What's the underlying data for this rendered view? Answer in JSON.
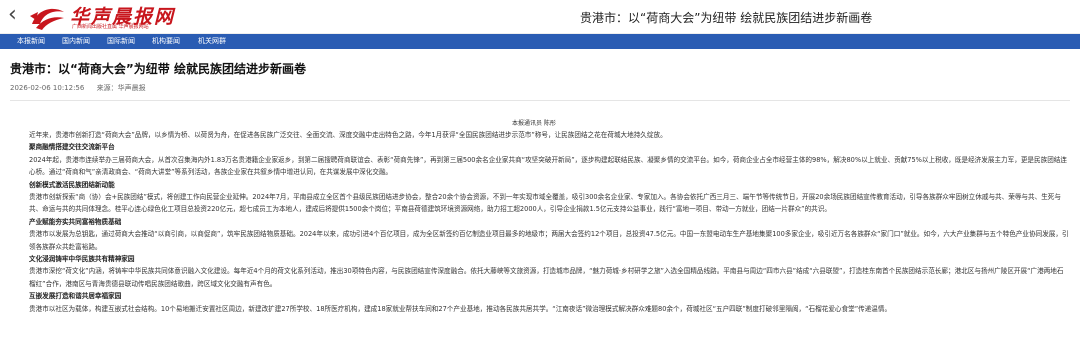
{
  "topbar": {
    "back_label": "‹",
    "logo_name": "华声晨报网",
    "logo_sub": "广西新闻出版社直属 华声晨报网站",
    "title": "贵港市：以“荷商大会”为纽带 绘就民族团结进步新画卷"
  },
  "nav": {
    "items": [
      "本报新闻",
      "国内新闻",
      "国际新闻",
      "机构要闻",
      "机关网群"
    ]
  },
  "article": {
    "headline": "贵港市：以“荷商大会”为纽带 绘就民族团结进步新画卷",
    "date": "2026-02-06 10:12:56",
    "source": "来源：华声晨报",
    "byline": "本报通讯员 陈彤",
    "blocks": [
      {
        "type": "p",
        "text": "近年来，贵港市创新打造“荷商大会”品牌，以乡情为桥、以荷贤为舟，在促进各民族广泛交往、全面交流、深度交融中走出特色之路，今年1月获评“全国民族团结进步示范市”称号，让民族团结之花在荷城大地持久绽放。"
      },
      {
        "type": "h",
        "text": "聚商融情搭建交往交流新平台"
      },
      {
        "type": "p",
        "text": "2024年起，贵港市连续举办三届荷商大会，从首次召集海内外1.83万名贵港籍企业家返乡，到第二届搜聘荷商联谊会、表彰“荷商先锋”，再到第三届500余名企业家共商“攻坚突破开新局”，逐步构建起联结民族、凝聚乡情的交流平台。如今，荷商企业占全市经营主体的98%，解决80%以上就业、贡献75%以上税收，既是经济发展主力军，更是民族团结连心桥。通过“荷商和气”亲清政商会、“荷商大讲堂”等系列活动，各族企业家在共叙乡情中增进认同，在共谋发展中深化交融。"
      },
      {
        "type": "h",
        "text": "创新模式激活民族团结新动能"
      },
      {
        "type": "p",
        "text": "贵港市创新探索“商（协）会+民族团结”模式，将创建工作向民营企业延伸。2024年7月，平南县成立全区首个县级民族团结进步协会，整合20余个协会资源，不到一年实现市域全覆盖，吸引300余名企业家、专家加入。各协会依托广西三月三、端午节等传统节日，开展20余场民族团结宣传教育活动，引导各族群众牢固树立休戚与共、荣辱与共、生死与共、命运与共的共同体理念。桂平心连心绿色化工项目总投资220亿元，超七成员工为本地人，建成后将提供1500余个岗位；平南县荷德建筑环境资源网络，助力招工超2000人，引导企业捐款1.5亿元支持公益事业，践行“富地一项目、带动一方就业，团结一片群众”的共识。"
      },
      {
        "type": "h",
        "text": "产业赋能夯实共同富裕物质基础"
      },
      {
        "type": "p",
        "text": "贵港市以发展为总钥匙，通过荷商大会推动“以商引商，以商促商”，筑牢民族团结物质基础。2024年以来，成功引进4个百亿项目，成为全区新签约百亿制造业项目最多的地级市；两届大会签约12个项目，总投资47.5亿元。中国一东盟电动车生产基地集聚100多家企业，吸引近万名各族群众“家门口”就业。如今，六大产业集群与五个特色产业协同发展，引领各族群众共赴富裕路。"
      },
      {
        "type": "h",
        "text": "文化浸润铸牢中华民族共有精神家园"
      },
      {
        "type": "p",
        "text": "贵港市深挖“荷文化”内涵，将铸牢中华民族共同体意识融入文化建设。每年近4个月的荷文化系列活动，推出30项特色内容，与民族团结宣传深度融合。依托大藤峡等文旅资源，打造城市品牌，“魅力荷城·乡村研学之旅”入选全国精品线路。平南县与周边“四市六县”结成“六县联盟”，打造桂东南首个民族团结示范长廊；港北区与扬州广陵区开展“广港两地石榴红”合作，港南区与青海贵德县联动传唱民族团结歌曲，跨区域文化交融有声有色。"
      },
      {
        "type": "h",
        "text": "互嵌发展打造和谐共居幸福家园"
      },
      {
        "type": "p",
        "text": "贵港市以社区为载体，构建互嵌式社会结构。10个易地搬迁安置社区周边，新建改扩建27所学校、18所医疗机构，建成18家就业帮扶车间和27个产业基地，推动各民族共居共学。“江南夜话”微治理模式解决群众难题80余个，荷城社区“五户四联”制度打破邻里隔阂，“石榴花爱心食堂”传递温情。"
      }
    ]
  }
}
